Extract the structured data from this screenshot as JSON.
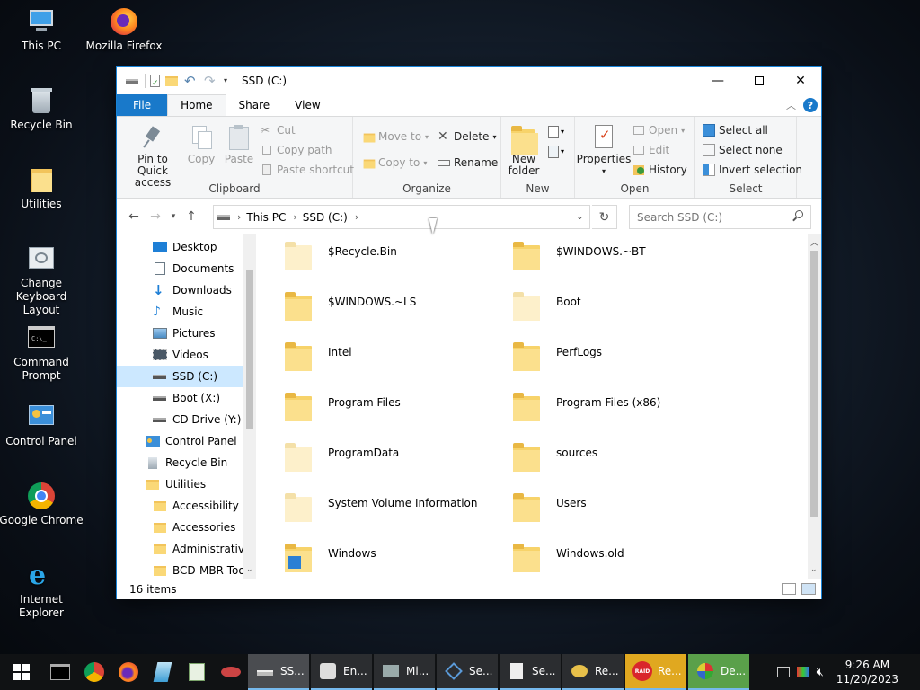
{
  "desktop": {
    "icons": [
      {
        "label": "This PC"
      },
      {
        "label": "Mozilla Firefox"
      },
      {
        "label": "Recycle Bin"
      },
      {
        "label": "Utilities"
      },
      {
        "label": "Change Keyboard Layout"
      },
      {
        "label": "Command Prompt"
      },
      {
        "label": "Control Panel"
      },
      {
        "label": "Google Chrome"
      },
      {
        "label": "Internet Explorer"
      }
    ]
  },
  "window": {
    "title": "SSD (C:)",
    "tabs": [
      "File",
      "Home",
      "Share",
      "View"
    ],
    "active_tab": "Home",
    "ribbon": {
      "clipboard": {
        "label": "Clipboard",
        "pin": "Pin to Quick access",
        "copy": "Copy",
        "paste": "Paste",
        "cut": "Cut",
        "copy_path": "Copy path",
        "paste_shortcut": "Paste shortcut"
      },
      "organize": {
        "label": "Organize",
        "move_to": "Move to",
        "copy_to": "Copy to",
        "delete": "Delete",
        "rename": "Rename"
      },
      "new": {
        "label": "New",
        "new_folder": "New folder"
      },
      "open": {
        "label": "Open",
        "properties": "Properties",
        "open": "Open",
        "edit": "Edit",
        "history": "History"
      },
      "select": {
        "label": "Select",
        "select_all": "Select all",
        "select_none": "Select none",
        "invert": "Invert selection"
      }
    },
    "address": {
      "crumbs": [
        "This PC",
        "SSD (C:)"
      ],
      "search_placeholder": "Search SSD (C:)"
    },
    "nav": [
      {
        "label": "Desktop"
      },
      {
        "label": "Documents"
      },
      {
        "label": "Downloads"
      },
      {
        "label": "Music"
      },
      {
        "label": "Pictures"
      },
      {
        "label": "Videos"
      },
      {
        "label": "SSD (C:)"
      },
      {
        "label": "Boot (X:)"
      },
      {
        "label": "CD Drive (Y:) H"
      },
      {
        "label": "Control Panel"
      },
      {
        "label": "Recycle Bin"
      },
      {
        "label": "Utilities"
      },
      {
        "label": "Accessibility"
      },
      {
        "label": "Accessories"
      },
      {
        "label": "Administrative"
      },
      {
        "label": "BCD-MBR Tool"
      }
    ],
    "files": [
      {
        "name": "$Recycle.Bin",
        "pale": true
      },
      {
        "name": "$WINDOWS.~BT",
        "pale": false
      },
      {
        "name": "$WINDOWS.~LS",
        "pale": false
      },
      {
        "name": "Boot",
        "pale": true
      },
      {
        "name": "Intel",
        "pale": false
      },
      {
        "name": "PerfLogs",
        "pale": false
      },
      {
        "name": "Program Files",
        "pale": false
      },
      {
        "name": "Program Files (x86)",
        "pale": false
      },
      {
        "name": "ProgramData",
        "pale": true
      },
      {
        "name": "sources",
        "pale": false
      },
      {
        "name": "System Volume Information",
        "pale": true
      },
      {
        "name": "Users",
        "pale": false
      },
      {
        "name": "Windows",
        "pale": false
      },
      {
        "name": "Windows.old",
        "pale": false
      }
    ],
    "status": "16 items"
  },
  "taskbar": {
    "apps": [
      {
        "label": "SS..."
      },
      {
        "label": "En..."
      },
      {
        "label": "Mi..."
      },
      {
        "label": "Se..."
      },
      {
        "label": "Se..."
      },
      {
        "label": "Re..."
      },
      {
        "label": "Re..."
      },
      {
        "label": "De..."
      }
    ],
    "time": "9:26 AM",
    "date": "11/20/2023"
  }
}
